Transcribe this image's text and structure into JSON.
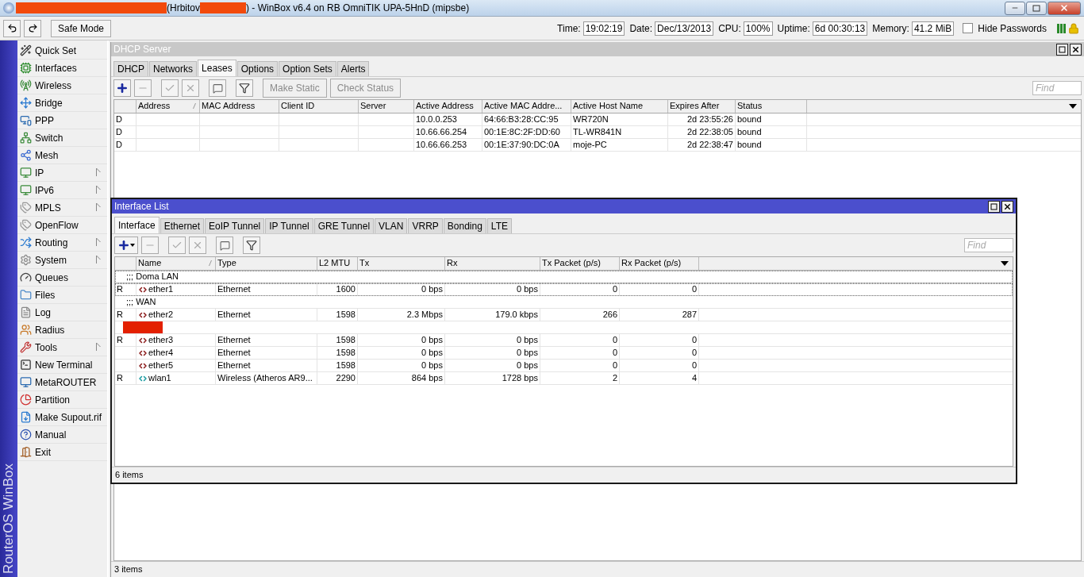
{
  "window": {
    "title_parts": [
      "(Hrbitov",
      ") - WinBox v6.4 on RB OmniTIK UPA-5HnD (mipsbe)"
    ]
  },
  "toolbar": {
    "safe_mode": "Safe Mode",
    "status": [
      {
        "label": "Time:",
        "value": "19:02:19"
      },
      {
        "label": "Date:",
        "value": "Dec/13/2013"
      },
      {
        "label": "CPU:",
        "value": "100%"
      },
      {
        "label": "Uptime:",
        "value": "6d 00:30:13"
      },
      {
        "label": "Memory:",
        "value": "41.2 MiB"
      }
    ],
    "hide_passwords": {
      "label": "Hide Passwords",
      "checked": false
    }
  },
  "sidebar": {
    "brand": "RouterOS WinBox",
    "items": [
      {
        "label": "Quick Set",
        "submenu": false
      },
      {
        "label": "Interfaces",
        "submenu": false
      },
      {
        "label": "Wireless",
        "submenu": false
      },
      {
        "label": "Bridge",
        "submenu": false
      },
      {
        "label": "PPP",
        "submenu": false
      },
      {
        "label": "Switch",
        "submenu": false
      },
      {
        "label": "Mesh",
        "submenu": false
      },
      {
        "label": "IP",
        "submenu": true
      },
      {
        "label": "IPv6",
        "submenu": true
      },
      {
        "label": "MPLS",
        "submenu": true
      },
      {
        "label": "OpenFlow",
        "submenu": false
      },
      {
        "label": "Routing",
        "submenu": true
      },
      {
        "label": "System",
        "submenu": true
      },
      {
        "label": "Queues",
        "submenu": false
      },
      {
        "label": "Files",
        "submenu": false
      },
      {
        "label": "Log",
        "submenu": false
      },
      {
        "label": "Radius",
        "submenu": false
      },
      {
        "label": "Tools",
        "submenu": true
      },
      {
        "label": "New Terminal",
        "submenu": false
      },
      {
        "label": "MetaROUTER",
        "submenu": false
      },
      {
        "label": "Partition",
        "submenu": false
      },
      {
        "label": "Make Supout.rif",
        "submenu": false
      },
      {
        "label": "Manual",
        "submenu": false
      },
      {
        "label": "Exit",
        "submenu": false
      }
    ]
  },
  "dhcp_window": {
    "title": "DHCP Server",
    "tabs": [
      {
        "label": "DHCP",
        "selected": false
      },
      {
        "label": "Networks",
        "selected": false
      },
      {
        "label": "Leases",
        "selected": true
      },
      {
        "label": "Options",
        "selected": false
      },
      {
        "label": "Option Sets",
        "selected": false
      },
      {
        "label": "Alerts",
        "selected": false
      }
    ],
    "actions": [
      {
        "label": "Make Static",
        "disabled": true
      },
      {
        "label": "Check Status",
        "disabled": true
      }
    ],
    "find": {
      "placeholder": "Find"
    },
    "columns": [
      {
        "label": "Address",
        "sorted": true
      },
      {
        "label": "MAC Address",
        "sorted": false
      },
      {
        "label": "Client ID",
        "sorted": false
      },
      {
        "label": "Server",
        "sorted": false
      },
      {
        "label": "Active Address",
        "sorted": false
      },
      {
        "label": "Active MAC Addre...",
        "sorted": false
      },
      {
        "label": "Active Host Name",
        "sorted": false
      },
      {
        "label": "Expires After",
        "sorted": false
      },
      {
        "label": "Status",
        "sorted": false
      }
    ],
    "rows": [
      {
        "flag": "D",
        "cells": [
          "",
          "",
          "",
          "",
          "10.0.0.253",
          "64:66:B3:28:CC:95",
          "WR720N",
          "2d 23:55:26",
          "bound"
        ]
      },
      {
        "flag": "D",
        "cells": [
          "",
          "",
          "",
          "",
          "10.66.66.254",
          "00:1E:8C:2F:DD:60",
          "TL-WR841N",
          "2d 22:38:05",
          "bound"
        ]
      },
      {
        "flag": "D",
        "cells": [
          "",
          "",
          "",
          "",
          "10.66.66.253",
          "00:1E:37:90:DC:0A",
          "moje-PC",
          "2d 22:38:47",
          "bound"
        ]
      }
    ],
    "status": "3 items"
  },
  "interface_window": {
    "title": "Interface List",
    "tabs": [
      {
        "label": "Interface",
        "selected": true
      },
      {
        "label": "Ethernet",
        "selected": false
      },
      {
        "label": "EoIP Tunnel",
        "selected": false
      },
      {
        "label": "IP Tunnel",
        "selected": false
      },
      {
        "label": "GRE Tunnel",
        "selected": false
      },
      {
        "label": "VLAN",
        "selected": false
      },
      {
        "label": "VRRP",
        "selected": false
      },
      {
        "label": "Bonding",
        "selected": false
      },
      {
        "label": "LTE",
        "selected": false
      }
    ],
    "find": {
      "placeholder": "Find"
    },
    "columns": [
      {
        "label": "Name",
        "sorted": true
      },
      {
        "label": "Type",
        "sorted": false
      },
      {
        "label": "L2 MTU",
        "sorted": false
      },
      {
        "label": "Tx",
        "sorted": false
      },
      {
        "label": "Rx",
        "sorted": false
      },
      {
        "label": "Tx Packet (p/s)",
        "sorted": false
      },
      {
        "label": "Rx Packet (p/s)",
        "sorted": false
      }
    ],
    "rows": [
      {
        "kind": "comment",
        "text": ";;; Doma LAN",
        "focused": true
      },
      {
        "kind": "ethernet",
        "flag": "R",
        "cells": [
          "ether1",
          "Ethernet",
          "1600",
          "0 bps",
          "0 bps",
          "0",
          "0"
        ],
        "focused": true
      },
      {
        "kind": "comment",
        "text": ";;; WAN",
        "focused": false
      },
      {
        "kind": "ethernet",
        "flag": "R",
        "cells": [
          "ether2",
          "Ethernet",
          "1598",
          "2.3 Mbps",
          "179.0 kbps",
          "266",
          "287"
        ],
        "focused": false
      },
      {
        "kind": "redacted",
        "focused": false
      },
      {
        "kind": "ethernet",
        "flag": "R",
        "cells": [
          "ether3",
          "Ethernet",
          "1598",
          "0 bps",
          "0 bps",
          "0",
          "0"
        ],
        "focused": false
      },
      {
        "kind": "ethernet",
        "flag": "",
        "cells": [
          "ether4",
          "Ethernet",
          "1598",
          "0 bps",
          "0 bps",
          "0",
          "0"
        ],
        "focused": false
      },
      {
        "kind": "ethernet",
        "flag": "",
        "cells": [
          "ether5",
          "Ethernet",
          "1598",
          "0 bps",
          "0 bps",
          "0",
          "0"
        ],
        "focused": false
      },
      {
        "kind": "wireless",
        "flag": "R",
        "cells": [
          "wlan1",
          "Wireless (Atheros AR9...",
          "2290",
          "864 bps",
          "1728 bps",
          "2",
          "4"
        ],
        "focused": false
      }
    ],
    "status": "6 items"
  }
}
